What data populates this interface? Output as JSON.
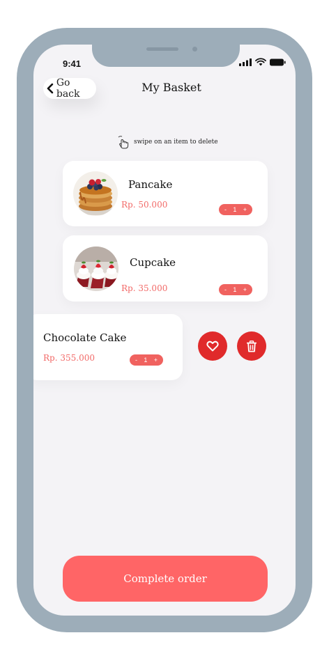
{
  "status_bar": {
    "time": "9:41"
  },
  "header": {
    "back_label": "Go back",
    "title": "My Basket"
  },
  "hint": {
    "text": "swipe on an item to delete",
    "icon": "swipe-hand-icon"
  },
  "basket": {
    "items": [
      {
        "name": "Pancake",
        "price": "Rp. 50.000",
        "quantity": "1",
        "minus": "-",
        "plus": "+"
      },
      {
        "name": "Cupcake",
        "price": "Rp. 35.000",
        "quantity": "1",
        "minus": "-",
        "plus": "+"
      },
      {
        "name": "Chocolate Cake",
        "price": "Rp. 355.000",
        "quantity": "1",
        "minus": "-",
        "plus": "+"
      }
    ]
  },
  "swipe_actions": {
    "favorite_icon": "heart-icon",
    "delete_icon": "trash-icon"
  },
  "footer": {
    "complete_label": "Complete order"
  },
  "colors": {
    "frame": "#9dadb9",
    "screen_bg": "#f4f3f6",
    "price": "#f26a68",
    "quantity_pill": "#f0625f",
    "action_button": "#e02a2b",
    "primary_button": "#ff6566"
  }
}
